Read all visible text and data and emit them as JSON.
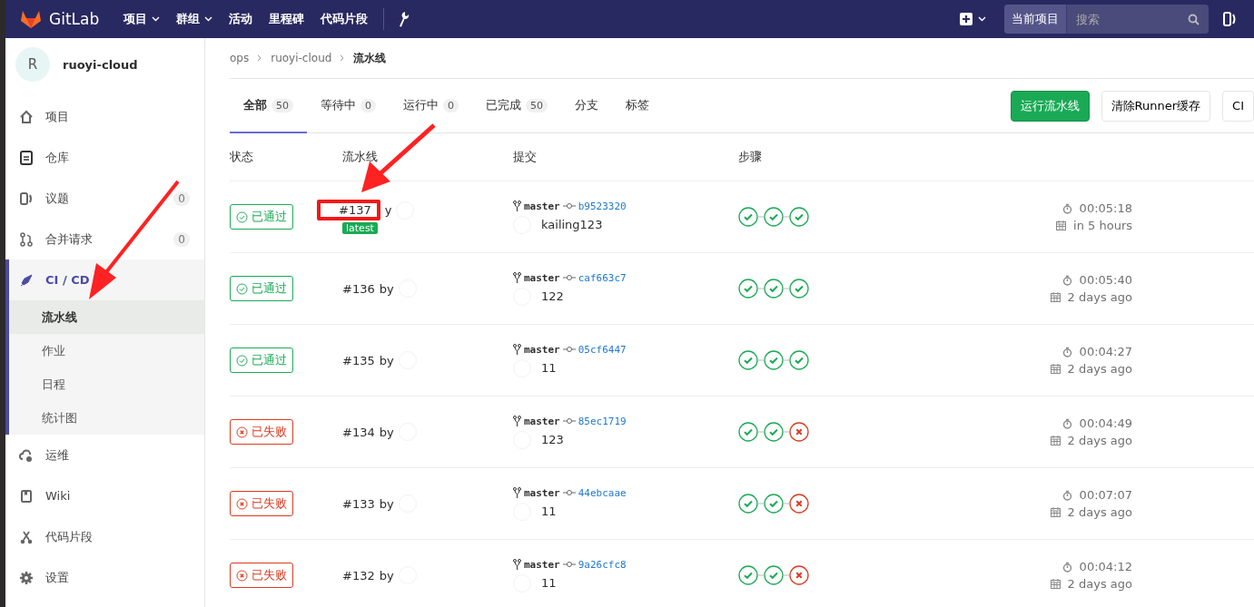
{
  "topbar": {
    "brand": "GitLab",
    "nav": [
      {
        "label": "项目",
        "dropdown": true
      },
      {
        "label": "群组",
        "dropdown": true
      },
      {
        "label": "活动",
        "dropdown": false
      },
      {
        "label": "里程碑",
        "dropdown": false
      },
      {
        "label": "代码片段",
        "dropdown": false
      }
    ],
    "scope": "当前项目",
    "search": {
      "placeholder": "搜索"
    }
  },
  "sidebar": {
    "avatar": "R",
    "project": "ruoyi-cloud",
    "items": [
      {
        "label": "项目",
        "selected": false
      },
      {
        "label": "仓库",
        "selected": false
      },
      {
        "label": "议题",
        "count": "0",
        "selected": false
      },
      {
        "label": "合并请求",
        "count": "0",
        "selected": false
      },
      {
        "label": "CI / CD",
        "selected": true,
        "children": [
          {
            "label": "流水线",
            "selected": true
          },
          {
            "label": "作业",
            "selected": false
          },
          {
            "label": "日程",
            "selected": false
          },
          {
            "label": "统计图",
            "selected": false
          }
        ]
      },
      {
        "label": "运维",
        "selected": false
      },
      {
        "label": "Wiki",
        "selected": false
      },
      {
        "label": "代码片段",
        "selected": false
      },
      {
        "label": "设置",
        "selected": false
      }
    ]
  },
  "breadcrumb": [
    "ops",
    "ruoyi-cloud",
    "流水线"
  ],
  "tabs": [
    {
      "label": "全部",
      "count": "50",
      "selected": true
    },
    {
      "label": "等待中",
      "count": "0",
      "selected": false
    },
    {
      "label": "运行中",
      "count": "0",
      "selected": false
    },
    {
      "label": "已完成",
      "count": "50",
      "selected": false
    },
    {
      "label": "分支",
      "selected": false
    },
    {
      "label": "标签",
      "selected": false
    }
  ],
  "actions": [
    "运行流水线",
    "清除Runner缓存",
    "CI"
  ],
  "table": {
    "columns": [
      "状态",
      "流水线",
      "提交",
      "步骤"
    ],
    "rows": [
      {
        "status": {
          "kind": "passed",
          "label": "已通过"
        },
        "pipeline": "#137",
        "highlighted": true,
        "by": "y",
        "latest": "latest",
        "branch": "master",
        "commit": "b9523320",
        "message": "kailing123",
        "stages": [
          {
            "kind": "success"
          },
          {
            "kind": "success"
          },
          {
            "kind": "success"
          }
        ],
        "duration": "00:05:18",
        "when": "in 5 hours"
      },
      {
        "status": {
          "kind": "passed",
          "label": "已通过"
        },
        "pipeline": "#136",
        "highlighted": false,
        "by": "by",
        "branch": "master",
        "commit": "caf663c7",
        "message": "122",
        "stages": [
          {
            "kind": "success"
          },
          {
            "kind": "success"
          },
          {
            "kind": "success"
          }
        ],
        "duration": "00:05:40",
        "when": "2 days ago"
      },
      {
        "status": {
          "kind": "passed",
          "label": "已通过"
        },
        "pipeline": "#135",
        "highlighted": false,
        "by": "by",
        "branch": "master",
        "commit": "05cf6447",
        "message": "11",
        "stages": [
          {
            "kind": "success"
          },
          {
            "kind": "success"
          },
          {
            "kind": "success"
          }
        ],
        "duration": "00:04:27",
        "when": "2 days ago"
      },
      {
        "status": {
          "kind": "failed",
          "label": "已失败"
        },
        "pipeline": "#134",
        "highlighted": false,
        "by": "by",
        "branch": "master",
        "commit": "85ec1719",
        "message": "123",
        "stages": [
          {
            "kind": "success"
          },
          {
            "kind": "success"
          },
          {
            "kind": "failed"
          }
        ],
        "duration": "00:04:49",
        "when": "2 days ago"
      },
      {
        "status": {
          "kind": "failed",
          "label": "已失败"
        },
        "pipeline": "#133",
        "highlighted": false,
        "by": "by",
        "branch": "master",
        "commit": "44ebcaae",
        "message": "11",
        "stages": [
          {
            "kind": "success"
          },
          {
            "kind": "success"
          },
          {
            "kind": "failed"
          }
        ],
        "duration": "00:07:07",
        "when": "2 days ago"
      },
      {
        "status": {
          "kind": "failed",
          "label": "已失败"
        },
        "pipeline": "#132",
        "highlighted": false,
        "by": "by",
        "branch": "master",
        "commit": "9a26cfc8",
        "message": "11",
        "stages": [
          {
            "kind": "success"
          },
          {
            "kind": "success"
          },
          {
            "kind": "failed"
          }
        ],
        "duration": "00:04:12",
        "when": "2 days ago"
      }
    ]
  }
}
